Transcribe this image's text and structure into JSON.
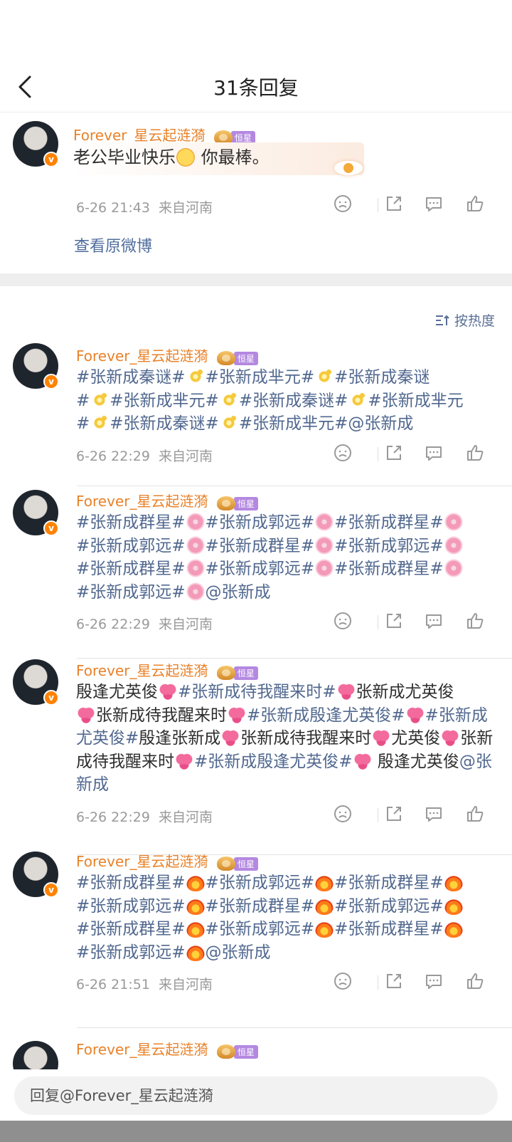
{
  "header": {
    "title": "31条回复"
  },
  "original_comment": {
    "username": "Forever_星云起涟漪",
    "rank_badge": "恒星",
    "text_before_emoji": "老公毕业快乐",
    "text_after_emoji": " 你最棒。",
    "time": "6-26 21:43",
    "location": "来自河南",
    "view_original": "查看原微博"
  },
  "sort_label": "按热度",
  "comments": [
    {
      "username": "Forever_星云起涟漪",
      "rank_badge": "恒星",
      "time": "6-26 22:29",
      "location": "来自河南"
    },
    {
      "username": "Forever_星云起涟漪",
      "rank_badge": "恒星",
      "time": "6-26 22:29",
      "location": "来自河南"
    },
    {
      "username": "Forever_星云起涟漪",
      "rank_badge": "恒星",
      "time": "6-26 22:29",
      "location": "来自河南"
    },
    {
      "username": "Forever_星云起涟漪",
      "rank_badge": "恒星",
      "time": "6-26 21:51",
      "location": "来自河南"
    },
    {
      "username": "Forever_星云起涟漪",
      "rank_badge": "恒星"
    }
  ],
  "c1_segments": [
    "#张新成秦谜#",
    "#张新成芈元#",
    "#张新成秦谜",
    "#",
    "#张新成芈元#",
    "#张新成秦谜#",
    "#张新成芈元",
    "#",
    "#张新成秦谜#",
    "#张新成芈元#@张新成"
  ],
  "c2_segments": [
    "#张新成群星#",
    "#张新成郭远#",
    "#张新成群星#",
    "#张新成郭远#",
    "#张新成群星#",
    "#张新成郭远#",
    "#张新成群星#",
    "#张新成郭远#",
    "#张新成群星#",
    "#张新成郭远#",
    "#张新成群星#",
    "#张新成郭远#",
    "@张新成"
  ],
  "c3_segments": {
    "a": "殷逢尤英俊",
    "b": "#张新成待我醒来时#",
    "c": "张新成尤英俊",
    "d": "张新成待我醒来时",
    "e": "#张新成殷逢尤英俊#",
    "f": "#张新成尤英俊#",
    "g": "殷逢张新成",
    "h": "张新成待我醒来时",
    "i": "尤英俊",
    "j": "张新成待我醒来时",
    "k": "#张新成殷逢尤英俊#",
    "l": " 殷逢尤英俊",
    "m": "@张新成"
  },
  "c4_segments": [
    "#张新成群星#",
    "#张新成郭远#",
    "#张新成群星#",
    "#张新成郭远#",
    "#张新成群星#",
    "#张新成郭远#",
    "#张新成群星#",
    "#张新成郭远#",
    "#张新成群星#",
    "#张新成郭远#",
    "#张新成群星#",
    "#张新成郭远#",
    "@张新成"
  ],
  "reply_bar": {
    "placeholder": "回复@Forever_星云起涟漪"
  },
  "icons": [
    "back-arrow-icon",
    "dislike-face-icon",
    "share-icon",
    "comment-icon",
    "like-thumb-icon",
    "sort-icon",
    "verified-v-icon",
    "crown-icon"
  ]
}
